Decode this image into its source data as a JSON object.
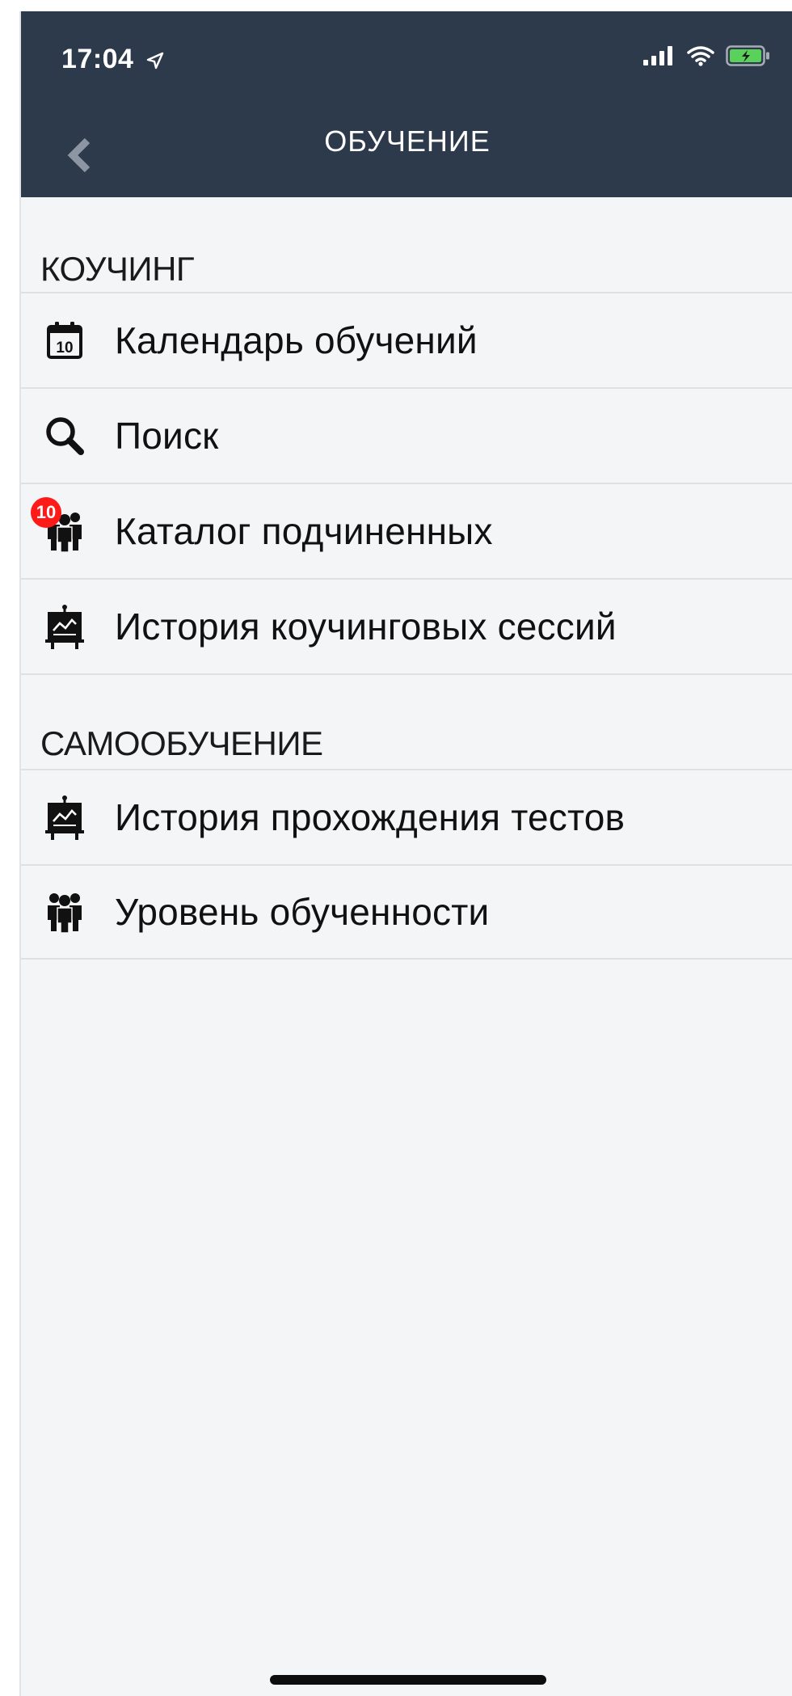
{
  "status_bar": {
    "time": "17:04",
    "location_icon": "location-arrow-icon",
    "signal_icon": "cellular-signal-icon",
    "wifi_icon": "wifi-icon",
    "battery_icon": "battery-charging-icon",
    "battery_color": "#5ad15a"
  },
  "header": {
    "title": "ОБУЧЕНИЕ",
    "back_icon": "chevron-left-icon",
    "background_color": "#2c3a4c"
  },
  "sections": [
    {
      "title": "КОУЧИНГ",
      "items": [
        {
          "label": "Календарь обучений",
          "icon": "calendar-icon"
        },
        {
          "label": "Поиск",
          "icon": "search-icon"
        },
        {
          "label": "Каталог подчиненных",
          "icon": "people-icon",
          "badge": "10"
        },
        {
          "label": "История коучинговых сессий",
          "icon": "presentation-board-icon"
        }
      ]
    },
    {
      "title": "САМООБУЧЕНИЕ",
      "items": [
        {
          "label": "История прохождения тестов",
          "icon": "presentation-board-icon"
        },
        {
          "label": "Уровень обученности",
          "icon": "people-icon"
        }
      ]
    }
  ],
  "calendar_day": "10",
  "badge_color": "#ff1a1a"
}
